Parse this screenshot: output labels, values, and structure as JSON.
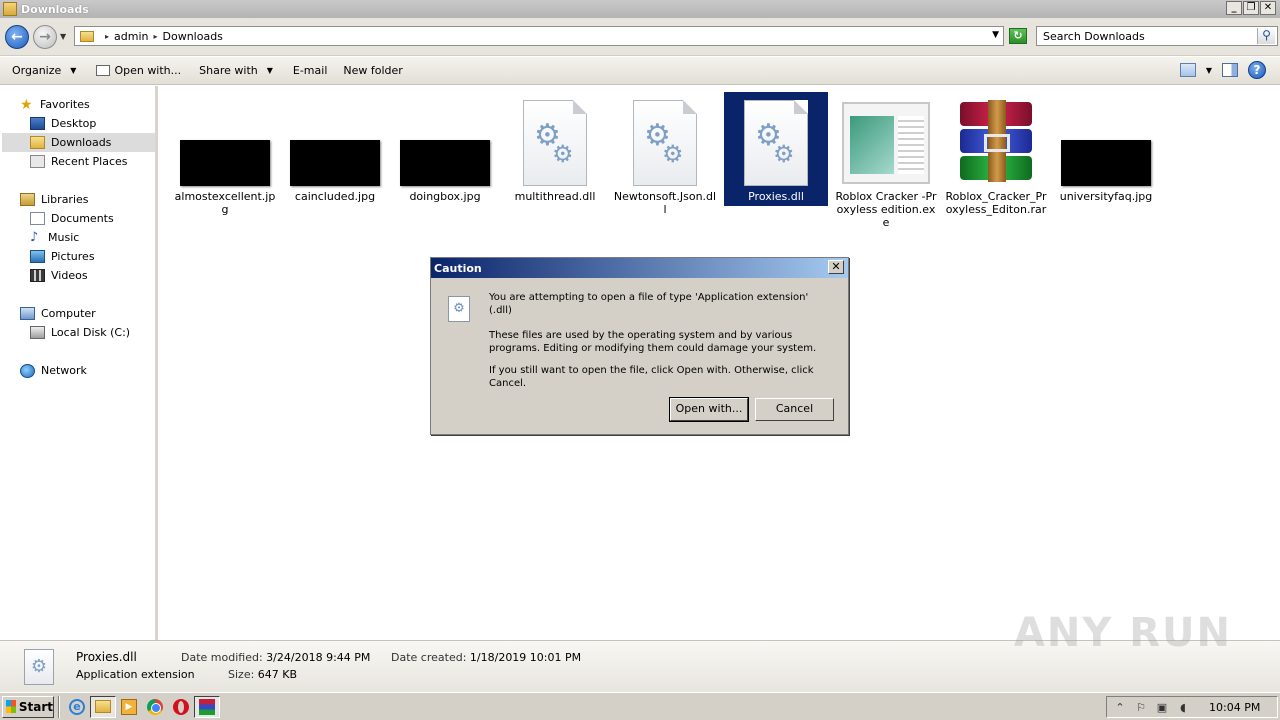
{
  "window": {
    "title": "Downloads"
  },
  "address": {
    "crumbs": [
      "admin",
      "Downloads"
    ],
    "search_placeholder": "Search Downloads"
  },
  "toolbar": {
    "organize": "Organize",
    "open_with": "Open with...",
    "share_with": "Share with",
    "email": "E-mail",
    "new_folder": "New folder"
  },
  "nav": {
    "favorites": "Favorites",
    "desktop": "Desktop",
    "downloads": "Downloads",
    "recent_places": "Recent Places",
    "libraries": "Libraries",
    "documents": "Documents",
    "music": "Music",
    "pictures": "Pictures",
    "videos": "Videos",
    "computer": "Computer",
    "local_disk": "Local Disk (C:)",
    "network": "Network"
  },
  "files": [
    {
      "name": "almostexcellent.jpg",
      "type": "jpg"
    },
    {
      "name": "caincluded.jpg",
      "type": "jpg"
    },
    {
      "name": "doingbox.jpg",
      "type": "jpg"
    },
    {
      "name": "multithread.dll",
      "type": "dll"
    },
    {
      "name": "Newtonsoft.Json.dll",
      "type": "dll"
    },
    {
      "name": "Proxies.dll",
      "type": "dll",
      "selected": true
    },
    {
      "name": "Roblox Cracker -Proxyless edition.exe",
      "type": "exe"
    },
    {
      "name": "Roblox_Cracker_Proxyless_Editon.rar",
      "type": "rar"
    },
    {
      "name": "universityfaq.jpg",
      "type": "jpg"
    }
  ],
  "dialog": {
    "title": "Caution",
    "line1": "You are attempting to open a file of type 'Application extension' (.dll)",
    "line2": "These files are used by the operating system and by various programs. Editing or modifying them could damage your system.",
    "line3": "If you still want to open the file, click Open with. Otherwise, click Cancel.",
    "open_with": "Open with...",
    "cancel": "Cancel"
  },
  "details": {
    "name": "Proxies.dll",
    "type": "Application extension",
    "modified_label": "Date modified:",
    "modified": "3/24/2018 9:44 PM",
    "created_label": "Date created:",
    "created": "1/18/2019 10:01 PM",
    "size_label": "Size:",
    "size": "647 KB"
  },
  "watermark": "ANY RUN",
  "taskbar": {
    "start": "Start",
    "clock": "10:04 PM"
  }
}
